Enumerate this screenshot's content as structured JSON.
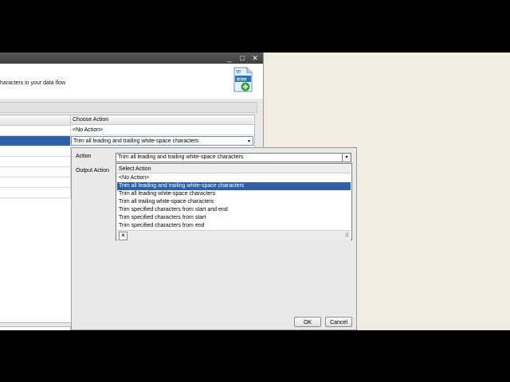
{
  "window": {
    "minimize": "_",
    "maximize": "□",
    "close": "✕"
  },
  "header": {
    "subtitle": "haracters in your data flow",
    "logo_tp": "TP",
    "logo_text": "trim"
  },
  "grid": {
    "column_header": "Choose Action",
    "rows": [
      {
        "action": "<No Action>"
      },
      {
        "action": "Trim all leading and trailing white-space characters"
      }
    ]
  },
  "popup": {
    "action_label": "Action",
    "output_action_label": "Output Action",
    "action_value": "Trim all leading and trailing white-space characters",
    "dropdown_header": "Select Action",
    "options": [
      "<No Action>",
      "Trim all leading and trailing white-space characters",
      "Trim all leading white-space characters",
      "Trim all trailing white-space characters",
      "Trim specified characters from start and end",
      "Trim specified characters from start",
      "Trim specified characters from end"
    ],
    "selected_index": 1,
    "ok_label": "OK",
    "cancel_label": "Cancel"
  },
  "colors": {
    "selection": "#2f5fa8",
    "titlebar": "#4a4a4a",
    "desktop": "#f0ece2"
  }
}
